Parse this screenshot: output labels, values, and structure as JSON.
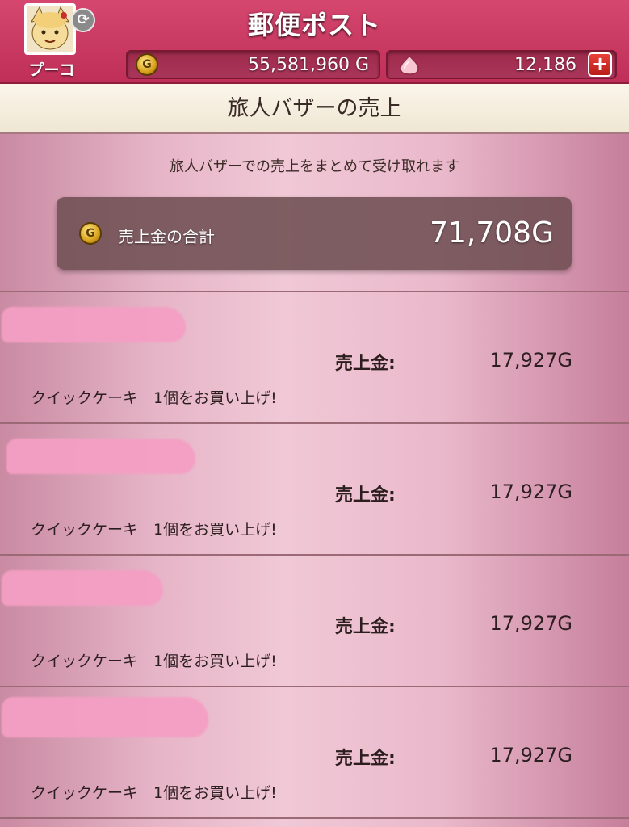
{
  "header": {
    "title": "郵便ポスト",
    "player_name": "プーコ",
    "gold_amount": "55,581,960 G",
    "gem_amount": "12,186",
    "coin_symbol": "G",
    "add_symbol": "+"
  },
  "section": {
    "title": "旅人バザーの売上",
    "description": "旅人バザーでの売上をまとめて受け取れます"
  },
  "total": {
    "label": "売上金の合計",
    "value": "71,708G"
  },
  "sales": [
    {
      "label": "売上金:",
      "amount": "17,927G",
      "description": "クイックケーキ　1個をお買い上げ!"
    },
    {
      "label": "売上金:",
      "amount": "17,927G",
      "description": "クイックケーキ　1個をお買い上げ!"
    },
    {
      "label": "売上金:",
      "amount": "17,927G",
      "description": "クイックケーキ　1個をお買い上げ!"
    },
    {
      "label": "売上金:",
      "amount": "17,927G",
      "description": "クイックケーキ　1個をお買い上げ!"
    }
  ],
  "colors": {
    "header": "#c93861",
    "redaction": "#f49fc4",
    "background": "#e6b5c7"
  }
}
